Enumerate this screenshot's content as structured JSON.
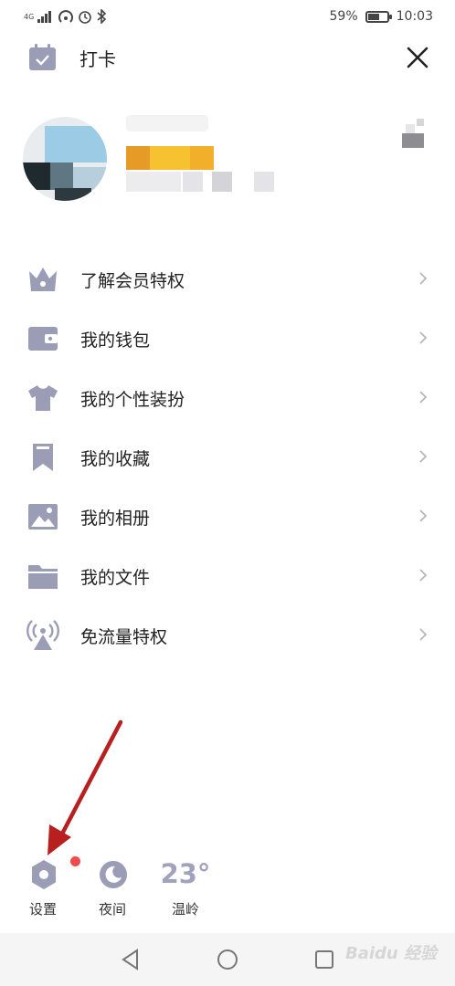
{
  "status_bar": {
    "network": "4G",
    "battery": "59%",
    "battery_level": 0.59,
    "time": "10:03"
  },
  "header": {
    "checkin_label": "打卡",
    "checkin_icon": "calendar-check-icon",
    "close_icon": "close-icon"
  },
  "menu": {
    "items": [
      {
        "label": "了解会员特权",
        "icon": "crown-basket-icon"
      },
      {
        "label": "我的钱包",
        "icon": "wallet-icon"
      },
      {
        "label": "我的个性装扮",
        "icon": "tshirt-icon"
      },
      {
        "label": "我的收藏",
        "icon": "bookmark-icon"
      },
      {
        "label": "我的相册",
        "icon": "photo-album-icon"
      },
      {
        "label": "我的文件",
        "icon": "folder-icon"
      },
      {
        "label": "免流量特权",
        "icon": "signal-tower-icon"
      }
    ]
  },
  "bottom_bar": {
    "settings_label": "设置",
    "night_label": "夜间",
    "weather_temp": "23°",
    "weather_city": "温岭"
  },
  "watermark": "Baidu 经验",
  "colors": {
    "icon": "#9b9db6",
    "accent_red": "#f24b4b",
    "arrow": "#b81f1f",
    "text": "#222222"
  }
}
